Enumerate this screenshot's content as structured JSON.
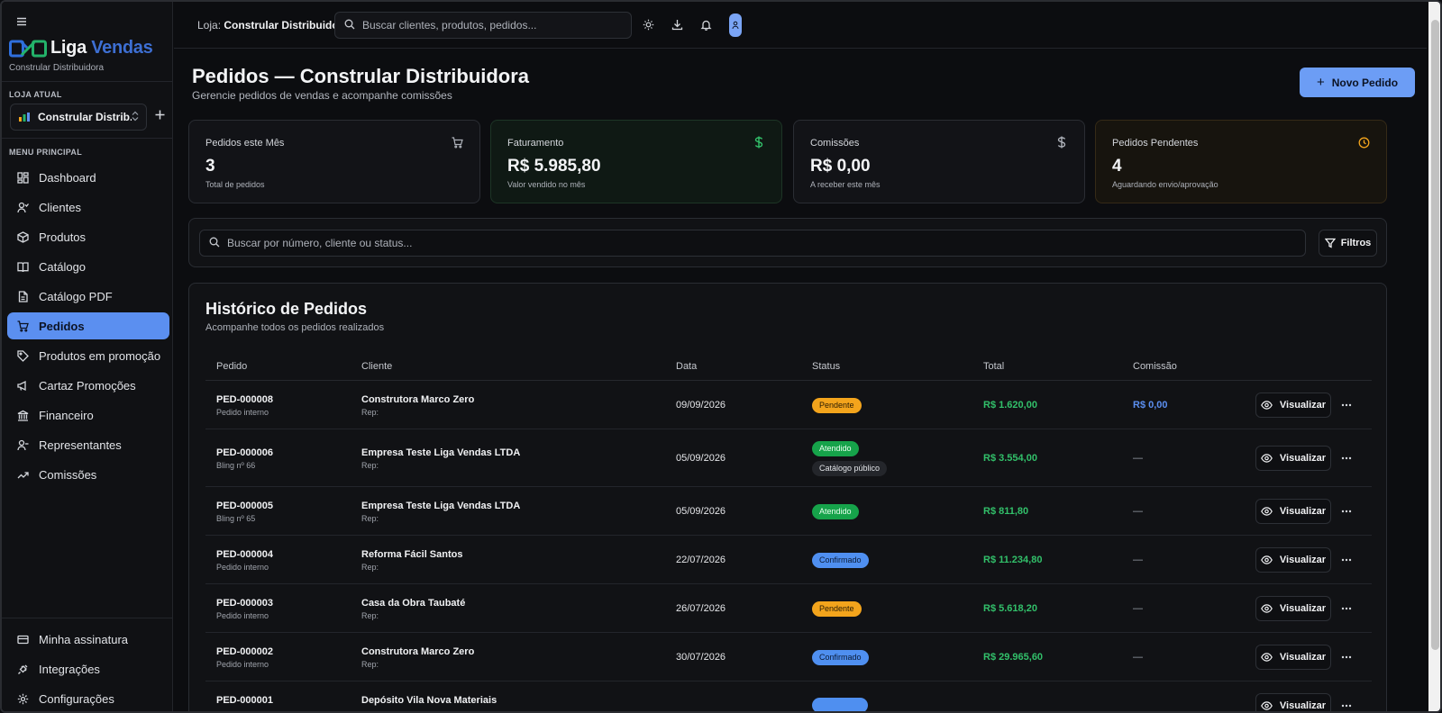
{
  "sidebar": {
    "brand": {
      "name_part1": "Liga",
      "name_part2": "Vendas",
      "subtitle": "Constrular Distribuidora"
    },
    "current_store_label": "LOJA ATUAL",
    "current_store_name": "Constrular Distrib...",
    "menu_label": "MENU PRINCIPAL",
    "items": [
      {
        "label": "Dashboard",
        "icon": "dashboard-icon",
        "active": false
      },
      {
        "label": "Clientes",
        "icon": "users-icon",
        "active": false
      },
      {
        "label": "Produtos",
        "icon": "box-icon",
        "active": false
      },
      {
        "label": "Catálogo",
        "icon": "book-icon",
        "active": false
      },
      {
        "label": "Catálogo PDF",
        "icon": "file-icon",
        "active": false
      },
      {
        "label": "Pedidos",
        "icon": "cart-icon",
        "active": true
      },
      {
        "label": "Produtos em promoção",
        "icon": "tag-icon",
        "active": false
      },
      {
        "label": "Cartaz Promoções",
        "icon": "megaphone-icon",
        "active": false
      },
      {
        "label": "Financeiro",
        "icon": "bank-icon",
        "active": false
      },
      {
        "label": "Representantes",
        "icon": "user-check-icon",
        "active": false
      },
      {
        "label": "Comissões",
        "icon": "trending-icon",
        "active": false
      }
    ],
    "bottom_items": [
      {
        "label": "Minha assinatura",
        "icon": "credit-card-icon"
      },
      {
        "label": "Integrações",
        "icon": "plug-icon"
      },
      {
        "label": "Configurações",
        "icon": "gear-icon"
      }
    ]
  },
  "topbar": {
    "store_prefix": "Loja:",
    "store_name": "Constrular Distribuidora",
    "search_placeholder": "Buscar clientes, produtos, pedidos..."
  },
  "page": {
    "title": "Pedidos — Constrular Distribuidora",
    "subtitle": "Gerencie pedidos de vendas e acompanhe comissões",
    "new_button": "Novo Pedido"
  },
  "stats": [
    {
      "label": "Pedidos este Mês",
      "value": "3",
      "sub": "Total de pedidos",
      "icon": "cart-icon",
      "icon_color": "#aeb2ba"
    },
    {
      "label": "Faturamento",
      "value": "R$ 5.985,80",
      "sub": "Valor vendido no mês",
      "icon": "dollar-icon",
      "icon_color": "#32c06a"
    },
    {
      "label": "Comissões",
      "value": "R$ 0,00",
      "sub": "A receber este mês",
      "icon": "dollar-icon",
      "icon_color": "#aeb2ba"
    },
    {
      "label": "Pedidos Pendentes",
      "value": "4",
      "sub": "Aguardando envio/aprovação",
      "icon": "clock-icon",
      "icon_color": "#f3a41c"
    }
  ],
  "filters": {
    "search_placeholder": "Buscar por número, cliente ou status...",
    "button": "Filtros"
  },
  "history": {
    "title": "Histórico de Pedidos",
    "subtitle": "Acompanhe todos os pedidos realizados",
    "columns": [
      "Pedido",
      "Cliente",
      "Data",
      "Status",
      "Total",
      "Comissão"
    ],
    "view_label": "Visualizar",
    "rows": [
      {
        "id": "PED-000008",
        "origin": "Pedido interno",
        "client": "Construtora Marco Zero",
        "rep": "Rep:",
        "date": "09/09/2026",
        "status": "Pendente",
        "status_type": "pendente",
        "tag": "",
        "total": "R$ 1.620,00",
        "commission": "R$ 0,00"
      },
      {
        "id": "PED-000006",
        "origin": "Bling nº 66",
        "client": "Empresa Teste Liga Vendas LTDA",
        "rep": "Rep:",
        "date": "05/09/2026",
        "status": "Atendido",
        "status_type": "atendido",
        "tag": "Catálogo público",
        "total": "R$ 3.554,00",
        "commission": "—"
      },
      {
        "id": "PED-000005",
        "origin": "Bling nº 65",
        "client": "Empresa Teste Liga Vendas LTDA",
        "rep": "Rep:",
        "date": "05/09/2026",
        "status": "Atendido",
        "status_type": "atendido",
        "tag": "",
        "total": "R$ 811,80",
        "commission": "—"
      },
      {
        "id": "PED-000004",
        "origin": "Pedido interno",
        "client": "Reforma Fácil Santos",
        "rep": "Rep:",
        "date": "22/07/2026",
        "status": "Confirmado",
        "status_type": "confirmado",
        "tag": "",
        "total": "R$ 11.234,80",
        "commission": "—"
      },
      {
        "id": "PED-000003",
        "origin": "Pedido interno",
        "client": "Casa da Obra Taubaté",
        "rep": "Rep:",
        "date": "26/07/2026",
        "status": "Pendente",
        "status_type": "pendente",
        "tag": "",
        "total": "R$ 5.618,20",
        "commission": "—"
      },
      {
        "id": "PED-000002",
        "origin": "Pedido interno",
        "client": "Construtora Marco Zero",
        "rep": "Rep:",
        "date": "30/07/2026",
        "status": "Confirmado",
        "status_type": "confirmado",
        "tag": "",
        "total": "R$ 29.965,60",
        "commission": "—"
      },
      {
        "id": "PED-000001",
        "origin": "",
        "client": "Depósito Vila Nova Materiais",
        "rep": "",
        "date": "",
        "status": "",
        "status_type": "confirmado",
        "tag": "",
        "total": "",
        "commission": ""
      }
    ]
  }
}
